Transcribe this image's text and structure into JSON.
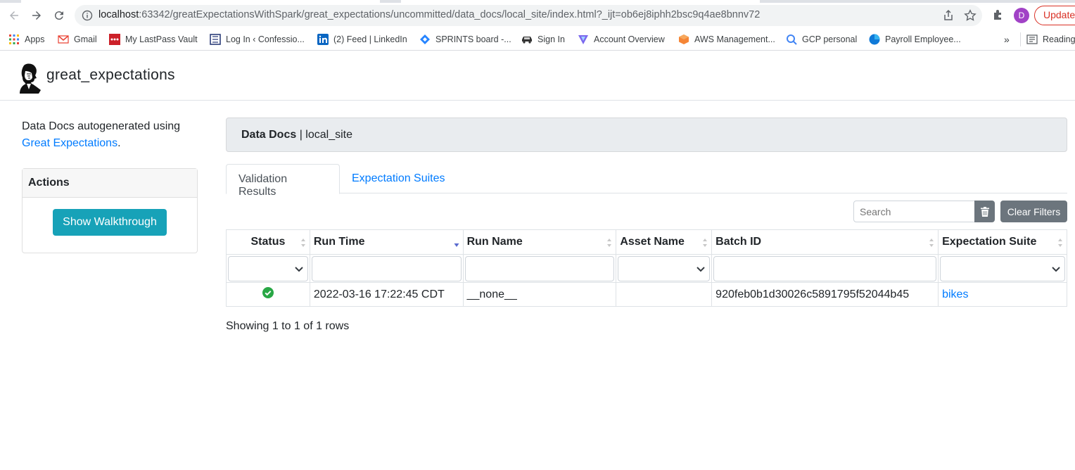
{
  "browser": {
    "url_host": "localhost",
    "url_rest": ":63342/greatExpectationsWithSpark/great_expectations/uncommitted/data_docs/local_site/index.html?_ijt=ob6ej8iphh2bsc9q4ae8bnnv72",
    "avatar_letter": "D",
    "update_label": "Update"
  },
  "bookmarks": [
    {
      "label": "Apps",
      "icon": "apps-grid-icon"
    },
    {
      "label": "Gmail",
      "icon": "gmail-icon"
    },
    {
      "label": "My LastPass Vault",
      "icon": "lastpass-icon"
    },
    {
      "label": "Log In ‹ Confessio...",
      "icon": "wordpress-icon"
    },
    {
      "label": "(2) Feed | LinkedIn",
      "icon": "linkedin-icon"
    },
    {
      "label": "SPRINTS board -...",
      "icon": "jira-icon"
    },
    {
      "label": "Sign In",
      "icon": "car-icon"
    },
    {
      "label": "Account Overview",
      "icon": "account-icon"
    },
    {
      "label": "AWS Management...",
      "icon": "aws-icon"
    },
    {
      "label": "GCP personal",
      "icon": "gcp-icon"
    },
    {
      "label": "Payroll Employee...",
      "icon": "payroll-icon"
    }
  ],
  "bookmarks_more": "»",
  "reading_list": "Reading",
  "site": {
    "brand": "great_expectations"
  },
  "sidebar": {
    "intro_text": "Data Docs autogenerated using",
    "intro_link": "Great Expectations",
    "intro_end": ".",
    "actions_title": "Actions",
    "walkthrough_label": "Show Walkthrough"
  },
  "main": {
    "breadcrumb_strong": "Data Docs",
    "breadcrumb_rest": " | local_site",
    "tabs": [
      "Validation Results",
      "Expectation Suites"
    ],
    "search_placeholder": "Search",
    "clear_filters": "Clear Filters",
    "columns": [
      "Status",
      "Run Time",
      "Run Name",
      "Asset Name",
      "Batch ID",
      "Expectation Suite"
    ],
    "rows": [
      {
        "status": "success",
        "run_time": "2022-03-16 17:22:45 CDT",
        "run_name": "__none__",
        "asset_name": "",
        "batch_id": "920feb0b1d30026c5891795f52044b45",
        "expectation_suite": "bikes"
      }
    ],
    "rows_info": "Showing 1 to 1 of 1 rows"
  },
  "colors": {
    "accent": "#007bff",
    "info_button": "#17a2b8",
    "secondary_button": "#6c757d",
    "success": "#28a745"
  }
}
